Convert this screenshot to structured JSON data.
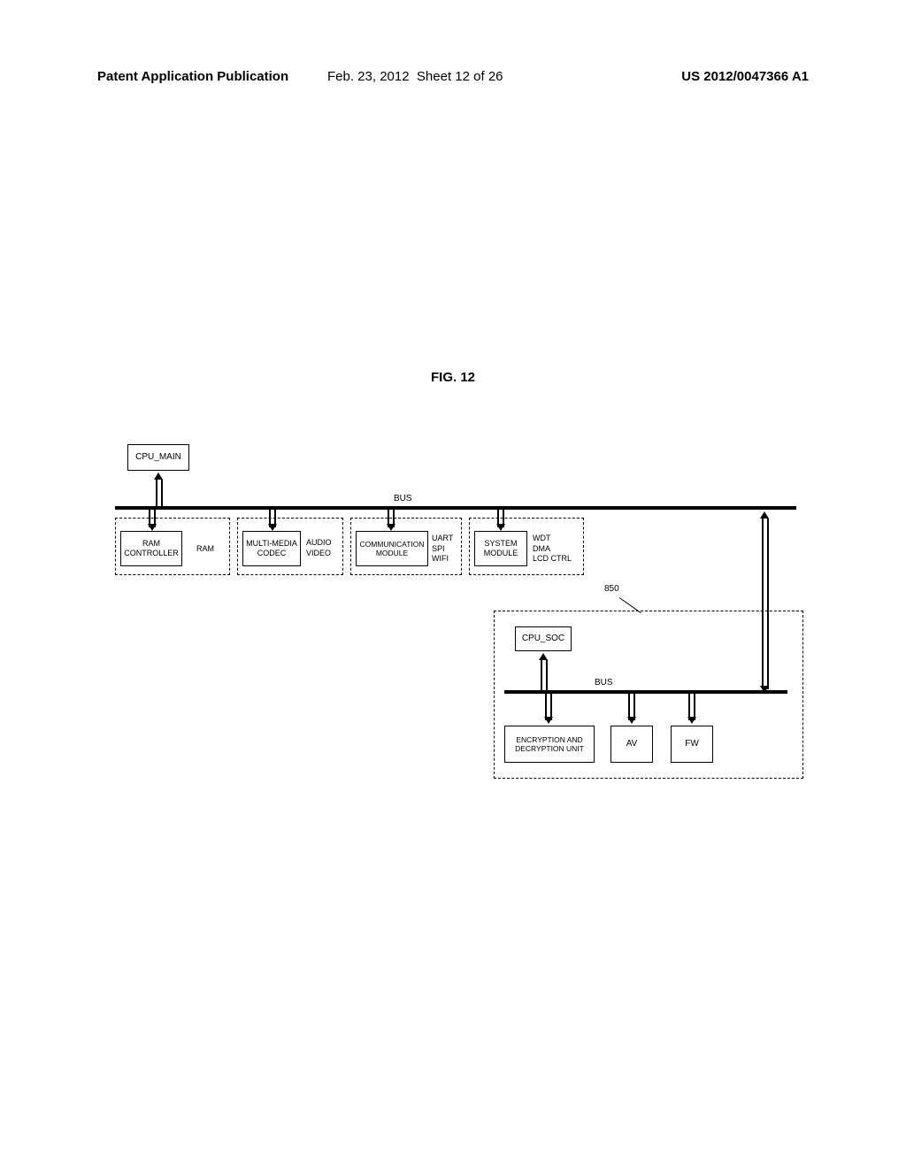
{
  "header": {
    "left": "Patent Application Publication",
    "mid_date": "Feb. 23, 2012",
    "mid_sheet": "Sheet 12 of 26",
    "right": "US 2012/0047366 A1"
  },
  "figure_title": "FIG. 12",
  "blocks": {
    "cpu_main": "CPU_MAIN",
    "ram_controller": "RAM CONTROLLER",
    "ram": "RAM",
    "mm_codec": "MULTI-MEDIA CODEC",
    "audio_video": "AUDIO VIDEO",
    "comm_module": "COMMUNICATION MODULE",
    "uart_spi_wifi": "UART\nSPI\nWIFI",
    "system_module": "SYSTEM MODULE",
    "wdt_dma_lcd": "WDT\nDMA\nLCD CTRL",
    "cpu_soc": "CPU_SOC",
    "enc_dec": "ENCRYPTION AND DECRYPTION UNIT",
    "av": "AV",
    "fw": "FW"
  },
  "bus_labels": {
    "main": "BUS",
    "soc": "BUS"
  },
  "ref": {
    "num850": "850"
  }
}
